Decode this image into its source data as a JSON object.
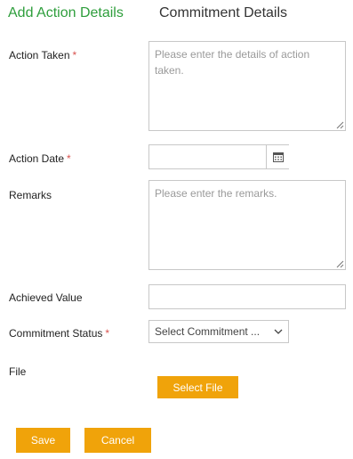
{
  "tabs": {
    "active": "Add Action Details",
    "inactive": "Commitment Details"
  },
  "form": {
    "action_taken": {
      "label": "Action Taken",
      "required": "*",
      "placeholder": "Please enter the details of action taken.",
      "value": ""
    },
    "action_date": {
      "label": "Action Date",
      "required": "*",
      "value": ""
    },
    "remarks": {
      "label": "Remarks",
      "placeholder": "Please enter the remarks.",
      "value": ""
    },
    "achieved_value": {
      "label": "Achieved Value",
      "value": ""
    },
    "commitment_status": {
      "label": "Commitment Status",
      "required": "*",
      "selected": "Select Commitment ..."
    },
    "file": {
      "label": "File",
      "button_label": "Select File"
    }
  },
  "actions": {
    "save_label": "Save",
    "cancel_label": "Cancel"
  },
  "colors": {
    "accent": "#2e9e3c",
    "button": "#f0a30a",
    "required": "#d9534f"
  },
  "icons": {
    "calendar": "calendar-icon",
    "dropdown": "chevron-down-icon"
  }
}
